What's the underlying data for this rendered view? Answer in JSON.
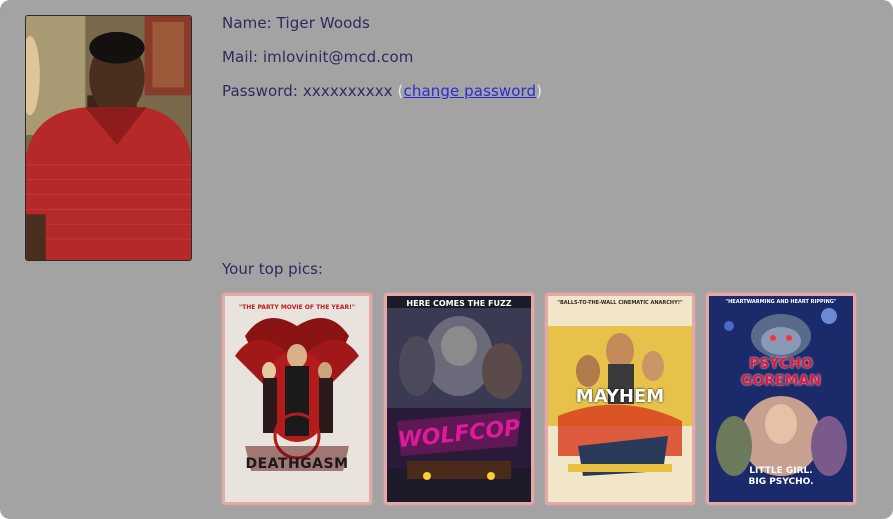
{
  "profile": {
    "name_line": "Name: Tiger Woods",
    "mail_line": "Mail: imlovinit@mcd.com",
    "password_prefix": "Password: xxxxxxxxxx ",
    "open_paren": "(",
    "change_password_label": "change password",
    "close_paren": ")"
  },
  "top_pics": {
    "title": "Your top pics:",
    "posters": [
      {
        "tagline": "\"THE PARTY MOVIE OF THE YEAR!\"",
        "title": "DEATHGASM"
      },
      {
        "tagline": "HERE COMES THE FUZZ",
        "title": "WOLFCOP"
      },
      {
        "tagline": "\"BALLS-TO-THE-WALL CINEMATIC ANARCHY!\"",
        "title": "MAYHEM"
      },
      {
        "tagline": "\"HEARTWARMING AND HEART RIPPING\"",
        "title": "PSYCHO GOREMAN",
        "subtitle": "LITTLE GIRL. BIG PSYCHO."
      }
    ]
  },
  "colors": {
    "card_bg": "#a3a3a3",
    "text": "#2f2a5e",
    "link": "#2b2bd6",
    "poster_border": "#e3a9a9"
  }
}
